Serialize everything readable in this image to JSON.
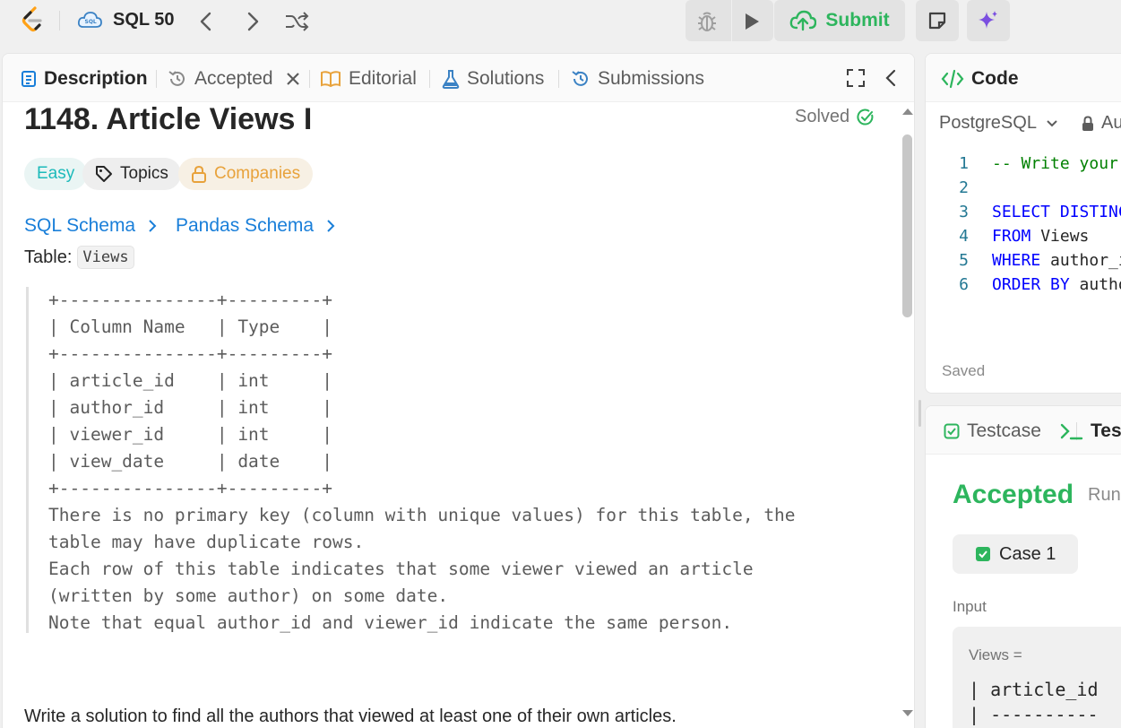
{
  "nav": {
    "list_title": "SQL 50",
    "submit_label": "Submit"
  },
  "left_tabs": [
    {
      "label": "Description"
    },
    {
      "label": "Accepted"
    },
    {
      "label": "Editorial"
    },
    {
      "label": "Solutions"
    },
    {
      "label": "Submissions"
    }
  ],
  "problem": {
    "title": "1148. Article Views I",
    "status": "Solved",
    "difficulty": "Easy",
    "topics_label": "Topics",
    "companies_label": "Companies",
    "sql_schema_label": "SQL Schema",
    "pandas_schema_label": "Pandas Schema",
    "table_prefix": "Table:",
    "table_name": "Views",
    "schema_lines": [
      "+---------------+---------+",
      "| Column Name   | Type    |",
      "+---------------+---------+",
      "| article_id    | int     |",
      "| author_id     | int     |",
      "| viewer_id     | int     |",
      "| view_date     | date    |",
      "+---------------+---------+",
      "There is no primary key (column with unique values) for this table, the",
      "table may have duplicate rows.",
      "Each row of this table indicates that some viewer viewed an article",
      "(written by some author) on some date.",
      "Note that equal author_id and viewer_id indicate the same person."
    ],
    "description_cut": "Write a solution to find all the authors that viewed at least one of their own articles."
  },
  "code_panel": {
    "tab_label": "Code",
    "language": "PostgreSQL",
    "auto_label": "Au",
    "saved_label": "Saved",
    "lines": [
      {
        "n": "1",
        "parts": [
          {
            "t": "-- Write your",
            "c": "cm"
          }
        ]
      },
      {
        "n": "2",
        "parts": []
      },
      {
        "n": "3",
        "parts": [
          {
            "t": "SELECT DISTINC",
            "c": "kw"
          }
        ]
      },
      {
        "n": "4",
        "parts": [
          {
            "t": "FROM",
            "c": "kw"
          },
          {
            "t": " Views",
            "c": ""
          }
        ]
      },
      {
        "n": "5",
        "parts": [
          {
            "t": "WHERE",
            "c": "kw"
          },
          {
            "t": " author_i",
            "c": ""
          }
        ]
      },
      {
        "n": "6",
        "parts": [
          {
            "t": "ORDER BY",
            "c": "kw"
          },
          {
            "t": " autho",
            "c": ""
          }
        ]
      }
    ]
  },
  "test_panel": {
    "testcase_label": "Testcase",
    "result_label": "Test",
    "status": "Accepted",
    "runtime_label": "Run",
    "case_label": "Case 1",
    "input_label": "Input",
    "input_var": "Views =",
    "input_lines": [
      "| article_id",
      "| ----------"
    ]
  },
  "colors": {
    "accent_green": "#2db55d",
    "easy": "#1cbaba",
    "companies": "#e8a23b",
    "link": "#1a7fd9",
    "keyword": "#0000ff",
    "comment": "#008000"
  }
}
